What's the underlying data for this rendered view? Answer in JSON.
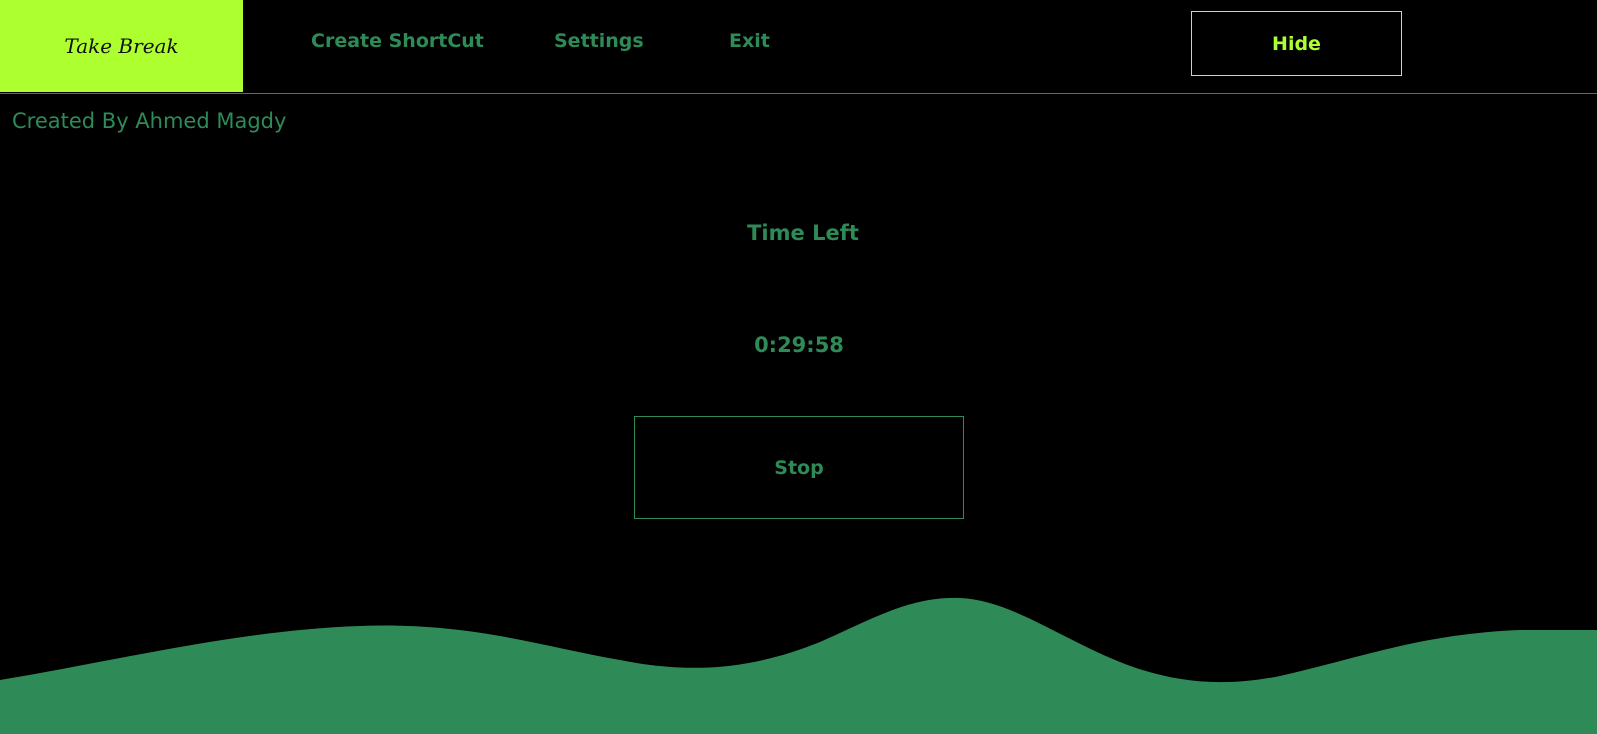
{
  "header": {
    "brand": "Take Break",
    "nav": {
      "create_shortcut": "Create ShortCut",
      "settings": "Settings",
      "exit": "Exit"
    },
    "hide_label": "Hide"
  },
  "credit": "Created By Ahmed Magdy",
  "timer": {
    "label": "Time Left",
    "value": "0:29:58",
    "stop_label": "Stop"
  },
  "colors": {
    "background": "#000000",
    "accent_lime": "#adff2f",
    "accent_green": "#2e8b57"
  }
}
